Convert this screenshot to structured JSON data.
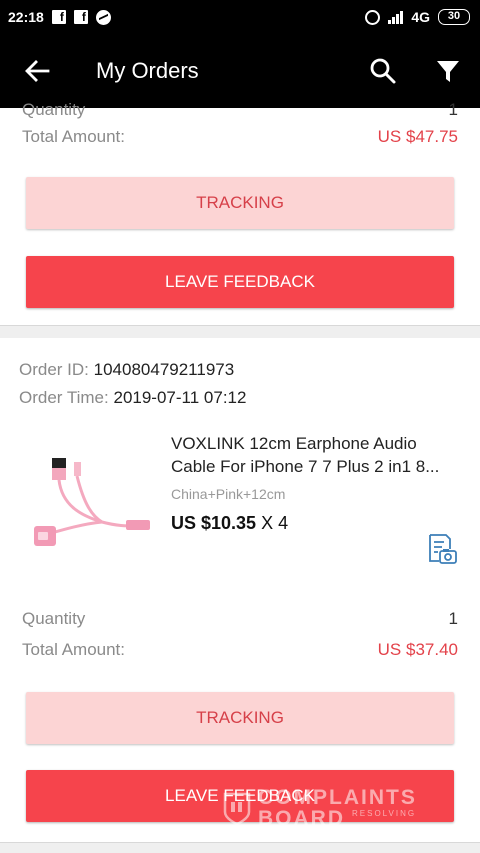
{
  "status_bar": {
    "time": "22:18",
    "network": "4G",
    "battery": "30"
  },
  "app_bar": {
    "title": "My Orders",
    "icons": [
      "back-arrow-icon",
      "search-icon",
      "filter-icon"
    ]
  },
  "orders": [
    {
      "quantity_label": "Quantity",
      "quantity": "1",
      "total_label": "Total Amount:",
      "total": "US $47.75",
      "tracking_label": "TRACKING",
      "feedback_label": "LEAVE FEEDBACK"
    },
    {
      "order_id_label": "Order ID:",
      "order_id": "104080479211973",
      "order_time_label": "Order Time:",
      "order_time": "2019-07-11 07:12",
      "product_name": "VOXLINK 12cm Earphone Audio Cable For iPhone 7 7 Plus 2 in1 8...",
      "product_variant": "China+Pink+12cm",
      "product_price": "US $10.35",
      "product_qty": "X 4",
      "quantity_label": "Quantity",
      "quantity": "1",
      "total_label": "Total Amount:",
      "total": "US $37.40",
      "tracking_label": "TRACKING",
      "feedback_label": "LEAVE FEEDBACK"
    }
  ],
  "watermark": {
    "line1": "COMPLAINTS",
    "line2": "BOARD",
    "line3": "RESOLVING"
  },
  "colors": {
    "accent": "#f6444c",
    "tracking_bg": "#fcd4d4",
    "amount": "#e3424a"
  }
}
